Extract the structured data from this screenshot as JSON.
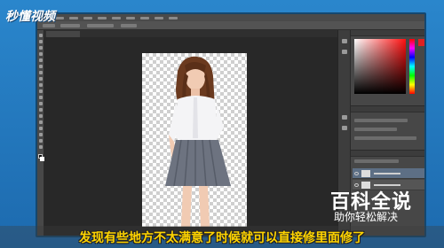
{
  "watermark": {
    "text": "秒懂视频"
  },
  "photoshop": {
    "document_tab": "",
    "canvas": {
      "background": "transparency-checker",
      "subject": "portrait photo cut-out"
    },
    "colors": {
      "foreground": "#111111",
      "background": "#ffffff",
      "picker_hue": "#ff1010"
    }
  },
  "brand": {
    "title": "百科全说",
    "subtitle": "助你轻松解决"
  },
  "subtitle": {
    "text": "发现有些地方不太满意了时候就可以直接修里面修了"
  },
  "colors": {
    "frame": "#1e6fb4",
    "subtitle_text": "#ffd400",
    "workspace": "#282828"
  }
}
